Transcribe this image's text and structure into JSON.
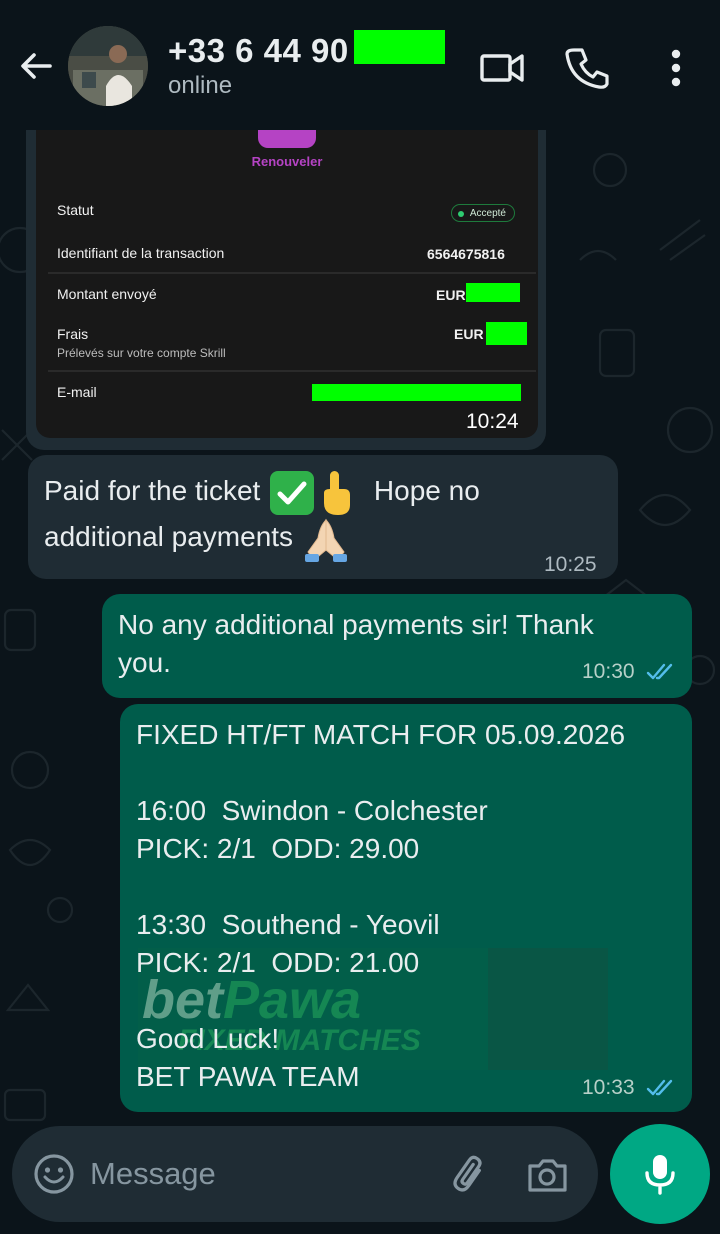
{
  "header": {
    "contact_name": "+33 6 44 90",
    "status": "online"
  },
  "skrill_card": {
    "renew_label": "Renouveler",
    "status_label": "Statut",
    "status_value": "Accepté",
    "transaction_label": "Identifiant de la transaction",
    "transaction_value": "6564675816",
    "amount_label": "Montant envoyé",
    "amount_currency": "EUR",
    "fees_label": "Frais",
    "fees_sub": "Prélevés sur votre compte Skrill",
    "fees_currency": "EUR",
    "email_label": "E-mail",
    "time": "10:24"
  },
  "messages": {
    "m1": {
      "line1": "Paid for the ticket",
      "line1b": "Hope no",
      "line2": "additional payments",
      "time": "10:25"
    },
    "m2": {
      "line1": "No any additional payments sir! Thank",
      "line2": "you.",
      "time": "10:30"
    },
    "m3": {
      "l1": "FIXED HT/FT MATCH FOR 05.09.2026",
      "l2": "",
      "l3": "16:00  Swindon - Colchester",
      "l4": "PICK: 2/1  ODD: 29.00",
      "l5": "",
      "l6": "13:30  Southend - Yeovil",
      "l7": "PICK: 2/1  ODD: 21.00",
      "l8": "",
      "l9": "Good Luck!",
      "l10": "BET PAWA TEAM",
      "time": "10:33"
    }
  },
  "watermark": {
    "brand_a": "bet",
    "brand_b": "Pawa",
    "tagline": "FIXED MATCHES"
  },
  "input": {
    "placeholder": "Message"
  },
  "colors": {
    "background": "#0b141a",
    "received_bubble": "#1f2c34",
    "sent_bubble": "#005c4b",
    "accent": "#00a884",
    "read_ticks": "#53bdeb",
    "redaction": "#00ff00"
  }
}
